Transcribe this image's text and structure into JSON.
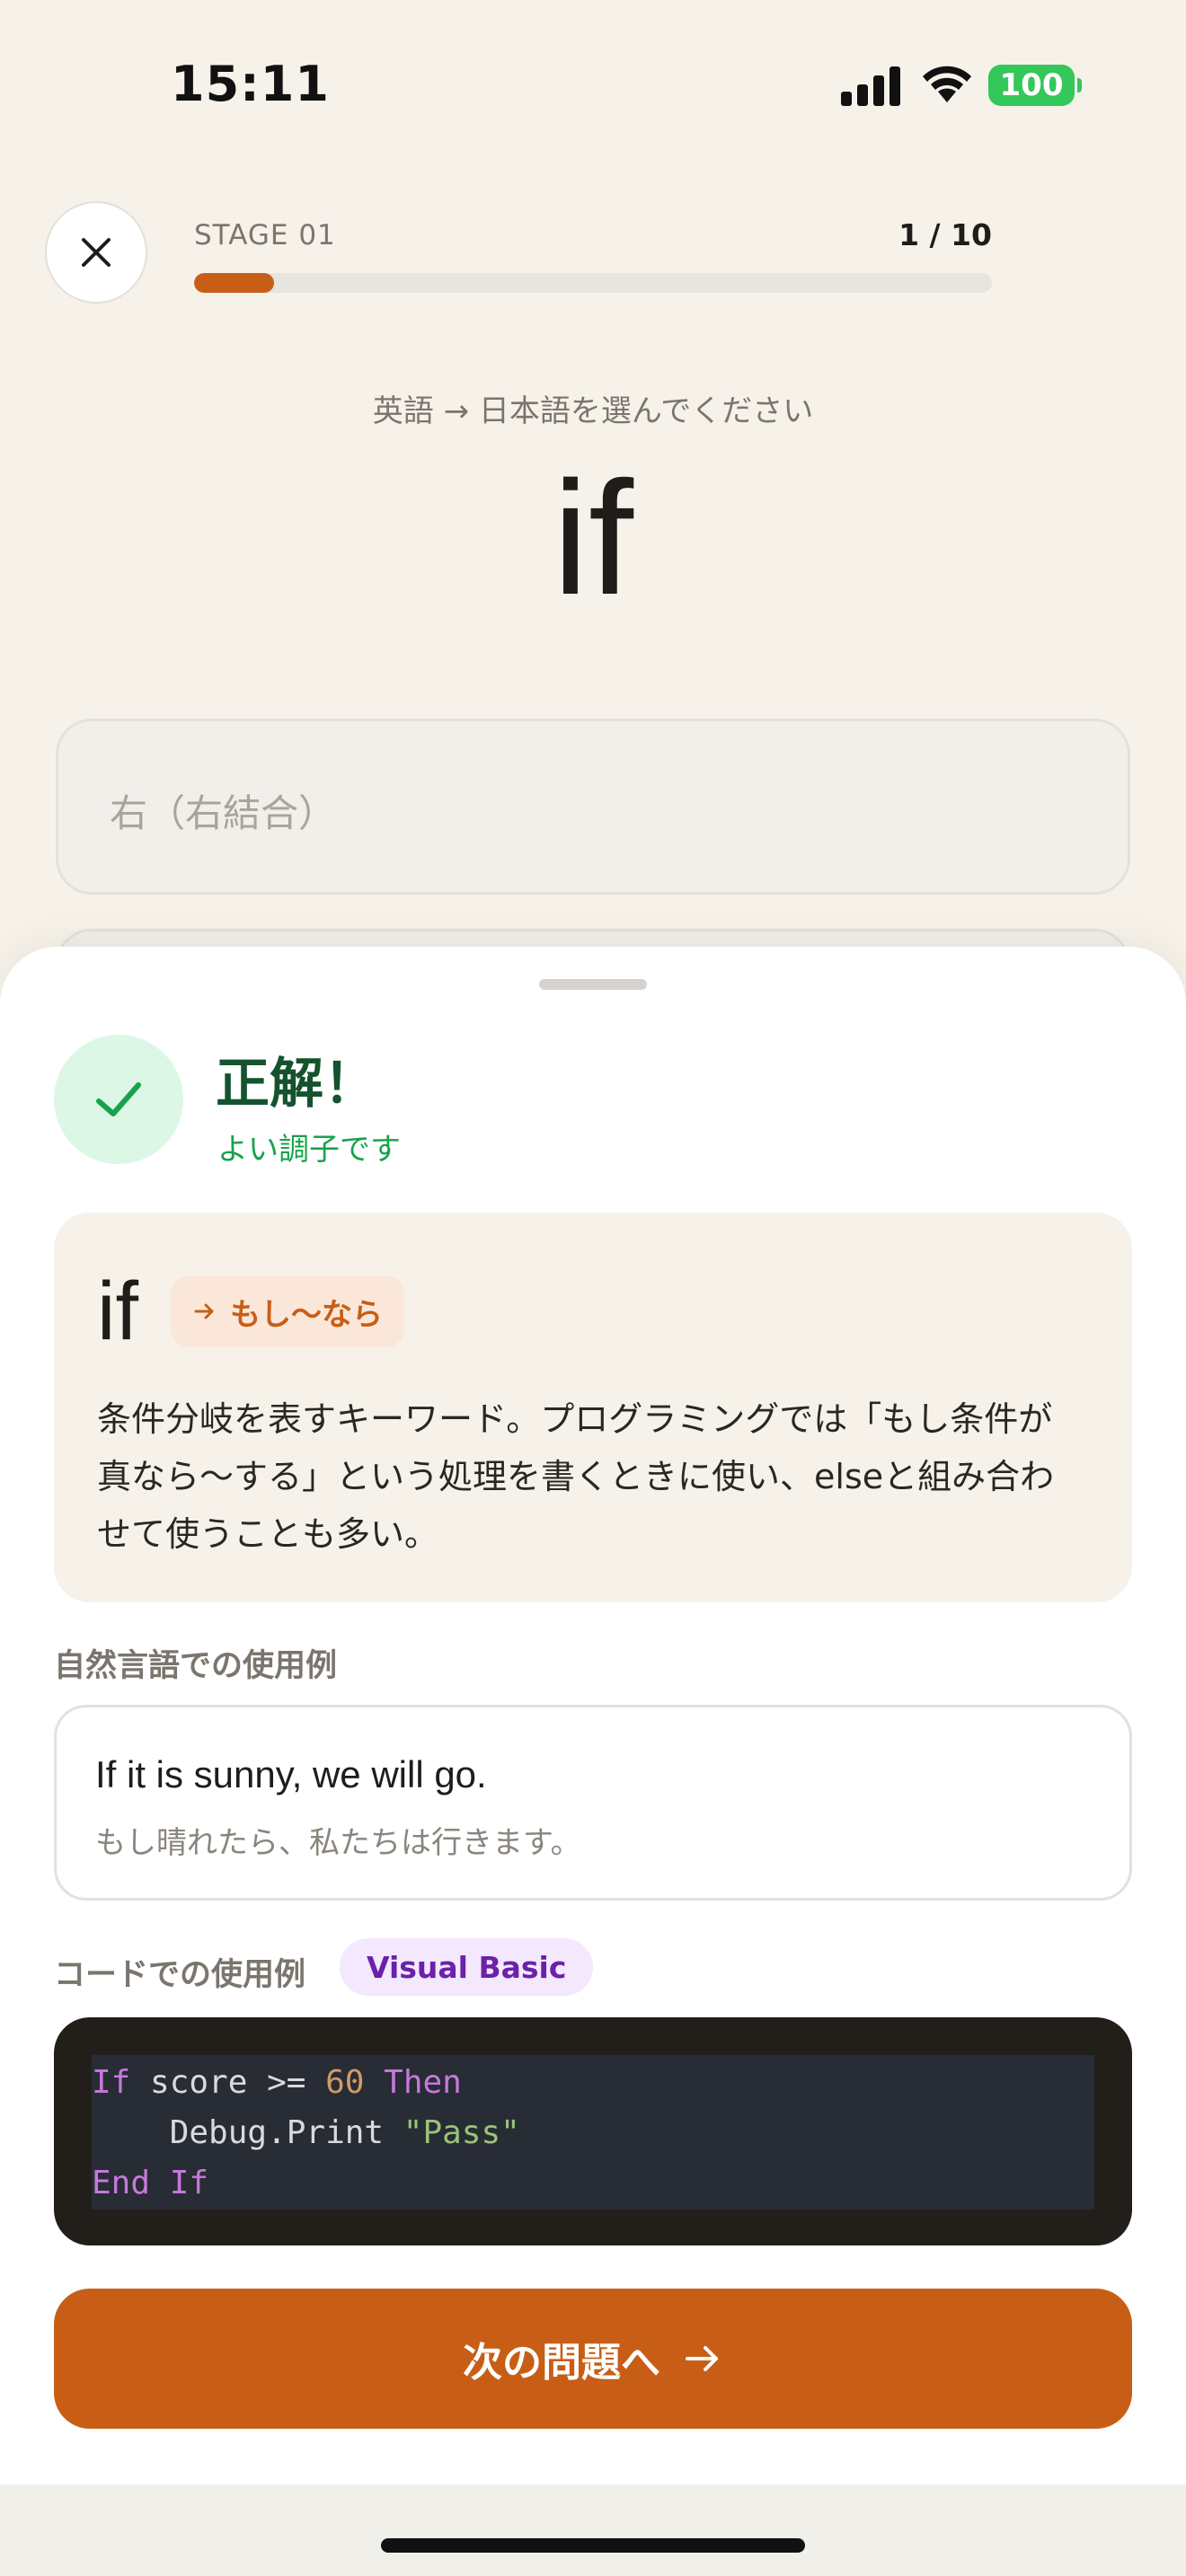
{
  "status_bar": {
    "time": "15:11",
    "battery": "100",
    "battery_color": "#34c759"
  },
  "header": {
    "close_icon": "close-icon",
    "stage_label": "STAGE 01",
    "progress_text": "1 / 10",
    "progress_fraction": 0.1,
    "accent_color": "#c85e16"
  },
  "question": {
    "prompt": "英語 → 日本語を選んでください",
    "word": "if",
    "options": [
      "右（右結合）"
    ]
  },
  "result": {
    "title": "正解！",
    "subtitle": "よい調子です",
    "icon": "check-icon"
  },
  "definition": {
    "word": "if",
    "meaning": "もし〜なら",
    "meaning_icon": "arrow-right-icon",
    "description": "条件分岐を表すキーワード。プログラミングでは「もし条件が真なら〜する」という処理を書くときに使い、elseと組み合わせて使うことも多い。"
  },
  "natural_example": {
    "label": "自然言語での使用例",
    "english": "If it is sunny, we will go.",
    "japanese": "もし晴れたら、私たちは行きます。"
  },
  "code_example": {
    "label": "コードでの使用例",
    "language": "Visual Basic",
    "lines": [
      [
        {
          "t": "If",
          "c": "kw"
        },
        {
          "t": " score >= ",
          "c": ""
        },
        {
          "t": "60",
          "c": "num"
        },
        {
          "t": " ",
          "c": ""
        },
        {
          "t": "Then",
          "c": "kw"
        }
      ],
      [
        {
          "t": "    Debug.Print ",
          "c": ""
        },
        {
          "t": "\"Pass\"",
          "c": "str"
        }
      ],
      [
        {
          "t": "End",
          "c": "kw"
        },
        {
          "t": " ",
          "c": ""
        },
        {
          "t": "If",
          "c": "kw"
        }
      ]
    ]
  },
  "next_button": {
    "label": "次の問題へ",
    "icon": "arrow-right-icon"
  }
}
